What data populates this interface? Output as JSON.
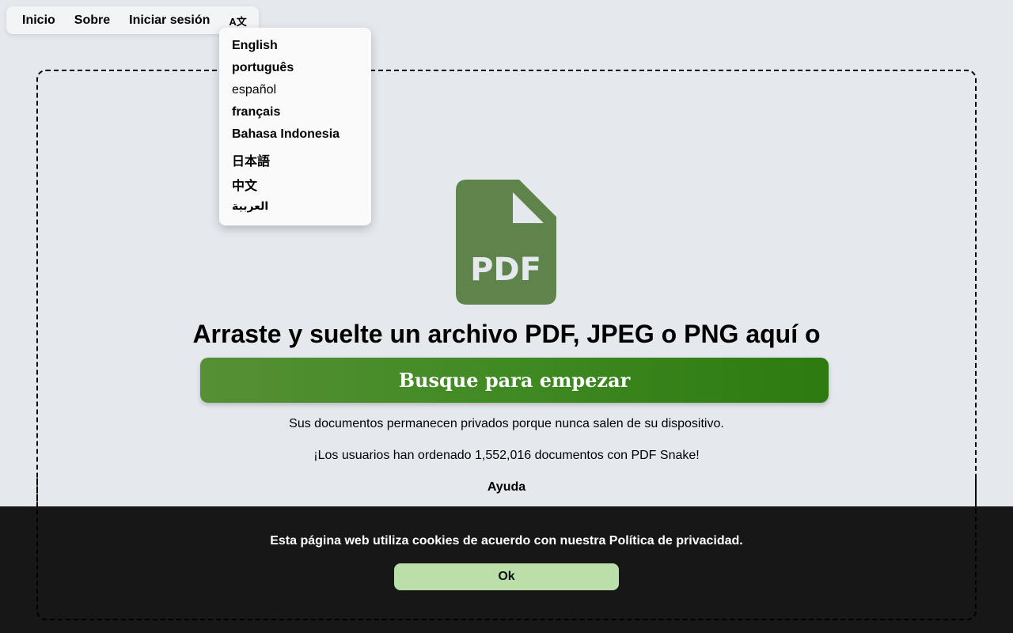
{
  "nav": {
    "items": [
      "Inicio",
      "Sobre",
      "Iniciar sesión"
    ],
    "lang_toggle": "A文"
  },
  "language_menu": {
    "items": [
      "English",
      "português",
      "español",
      "français",
      "Bahasa Indonesia",
      "日本語",
      "中文",
      "العربية"
    ],
    "current": "español"
  },
  "upload": {
    "icon": "pdf-file-icon",
    "icon_label": "PDF",
    "headline": "Arraste y suelte un archivo PDF, JPEG o PNG aquí o",
    "browse_label": "Busque para empezar",
    "privacy_note": "Sus documentos permanecen privados porque nunca salen de su dispositivo.",
    "stats_note": "¡Los usuarios han ordenado 1,552,016 documentos con PDF Snake!",
    "help_label": "Ayuda"
  },
  "cookie": {
    "message": "Esta página web utiliza cookies de acuerdo con nuestra Política de privacidad.",
    "ok_label": "Ok"
  },
  "colors": {
    "background": "#e5e9ee",
    "icon_green": "#5e844b",
    "button_gradient_start": "#568f35",
    "button_gradient_end": "#2c7a10",
    "banner": "#171717",
    "ok_button": "#bbdfa9"
  }
}
